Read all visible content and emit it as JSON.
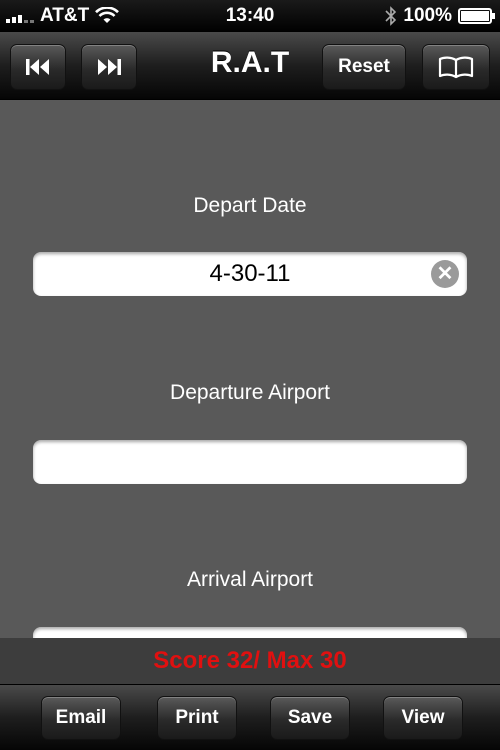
{
  "status_bar": {
    "carrier": "AT&T",
    "time": "13:40",
    "battery": "100%",
    "battery_level": 1.0,
    "icons": [
      "signal-icon",
      "wifi-icon",
      "bluetooth-icon",
      "battery-icon"
    ]
  },
  "nav": {
    "title": "R.A.T",
    "reset_label": "Reset",
    "icons": [
      "skip-back-icon",
      "skip-forward-icon",
      "book-icon"
    ]
  },
  "form": {
    "fields": [
      {
        "label": "Depart Date",
        "value": "4-30-11",
        "placeholder": ""
      },
      {
        "label": "Departure Airport",
        "value": "",
        "placeholder": ""
      },
      {
        "label": "Arrival Airport",
        "value": "",
        "placeholder": ""
      }
    ]
  },
  "score": {
    "text": "Score 32/ Max 30",
    "color": "#e01010"
  },
  "toolbar": {
    "email_label": "Email",
    "print_label": "Print",
    "save_label": "Save",
    "view_label": "View"
  }
}
